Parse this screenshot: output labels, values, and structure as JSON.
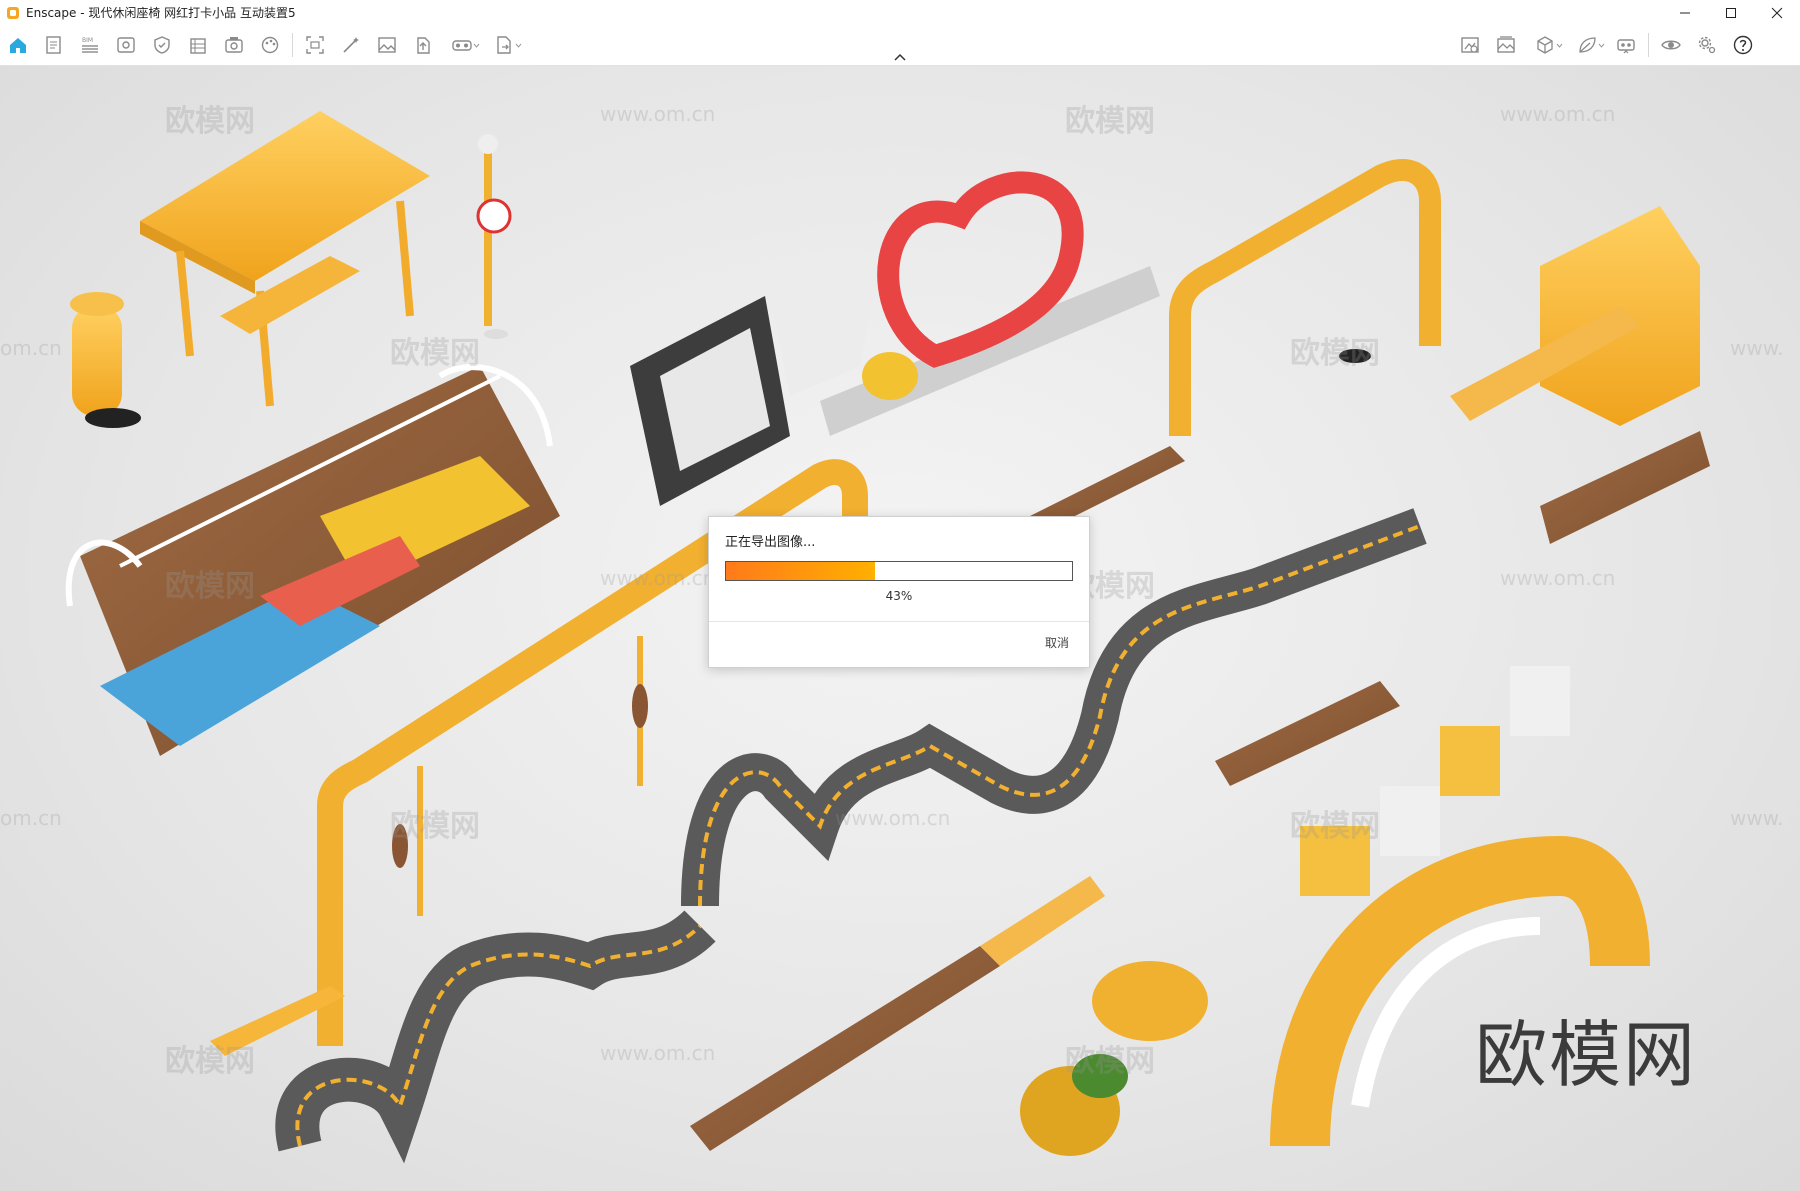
{
  "window": {
    "title": "Enscape - 现代休闲座椅 网红打卡小品 互动装置5",
    "controls": [
      "minimize",
      "maximize",
      "close"
    ]
  },
  "toolbar": {
    "left_tools": [
      {
        "icon": "home-icon",
        "active": true
      },
      {
        "icon": "document-icon"
      },
      {
        "icon": "bim-list-icon"
      },
      {
        "icon": "view-management-icon"
      },
      {
        "icon": "shield-icon"
      },
      {
        "icon": "building-icon"
      },
      {
        "icon": "asset-library-icon"
      },
      {
        "icon": "palette-icon"
      },
      {
        "icon": "capture-icon"
      },
      {
        "icon": "magic-icon"
      },
      {
        "icon": "image-icon"
      },
      {
        "icon": "upload-icon"
      },
      {
        "icon": "vr-headset-icon",
        "dropdown": true
      },
      {
        "icon": "export-icon",
        "dropdown": true
      }
    ],
    "right_tools": [
      {
        "icon": "camera-tag-icon"
      },
      {
        "icon": "gallery-icon"
      },
      {
        "icon": "cube-icon",
        "dropdown": true
      },
      {
        "icon": "leaf-icon",
        "dropdown": true
      },
      {
        "icon": "sync-icon"
      },
      {
        "icon": "eye-icon"
      },
      {
        "icon": "settings-icon"
      },
      {
        "icon": "help-icon"
      }
    ],
    "accent_color": "#29a9e0"
  },
  "viewport": {
    "watermarks": {
      "cn": "欧模网",
      "url": "www.om.cn",
      "url_partial_left": "om.cn",
      "url_partial_right": "www."
    },
    "brand_mark": "欧模网"
  },
  "dialog": {
    "title": "正在导出图像...",
    "progress_percent": 43,
    "progress_label": "43%",
    "cancel_label": "取消",
    "progress_colors": [
      "#ff7a1a",
      "#ffb000"
    ]
  }
}
